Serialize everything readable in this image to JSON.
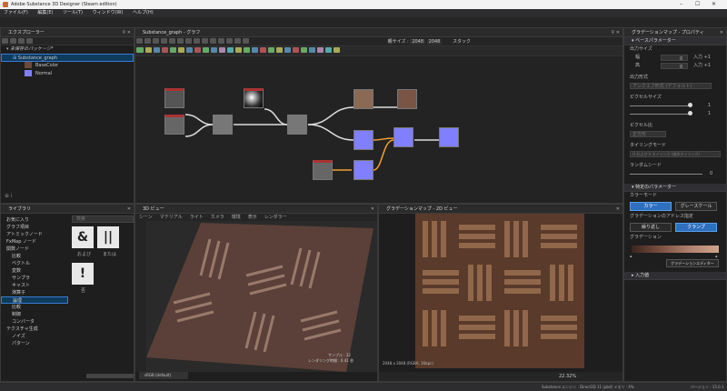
{
  "window": {
    "title": "Adobe Substance 3D Designer (Steam edition)"
  },
  "menu": [
    "ファイル(F)",
    "編集(E)",
    "ツール(T)",
    "ウィンドウ(W)",
    "ヘルプ(H)"
  ],
  "explorer": {
    "title": "エクスプローラー",
    "package": "未保存のパッケージ*",
    "graph": "Substance_graph",
    "outputs": [
      {
        "label": "BaseColor",
        "color": "#6b4a3a"
      },
      {
        "label": "Normal",
        "color": "#8080ff"
      }
    ]
  },
  "graph": {
    "title": "Substance_graph - グラフ",
    "size_label": "親サイズ :",
    "size1": "2048",
    "size2": "2048",
    "stack_label": "スタック"
  },
  "library": {
    "title": "ライブラリ",
    "search_placeholder": "検索",
    "items": [
      "お気に入り",
      "グラフ項目",
      "アトミックノード",
      "FxMap ノード",
      "関数ノード",
      "比較",
      "ベクトル",
      "変数",
      "サンプラ",
      "キャスト",
      "演算子",
      "論理",
      "比較",
      "制御",
      "コンバータ",
      "テクスチャ生成",
      "ノイズ",
      "パターン"
    ],
    "selected_index": 10,
    "tiles": [
      {
        "glyph": "&",
        "label": "および"
      },
      {
        "glyph": "||",
        "label": "または"
      },
      {
        "glyph": "!",
        "label": "否"
      }
    ]
  },
  "view3d": {
    "title": "3D ビュー",
    "menu": [
      "シーン",
      "マテリアル",
      "ライト",
      "カメラ",
      "環境",
      "表示",
      "レンダラー"
    ],
    "stats1": "サンプル : 32",
    "stats2": "レンダリング時間 : 0.41 秒",
    "colorspace": "sRGB (default)"
  },
  "view2d": {
    "title": "グラデーションマップ - 2D ビュー",
    "info": "2048 x 2048 (RGBA, 16bpc)",
    "zoom": "22.32%"
  },
  "props": {
    "title": "グラデーションマップ - プロパティ",
    "base_section": "ベースパラメーター",
    "output_size": "出力サイズ",
    "width_label": "幅",
    "height_label": "高",
    "width_val": "0",
    "height_val": "0",
    "rel_w": "入力 +1",
    "rel_h": "入力 +1",
    "output_format": "出力形式",
    "output_format_val": "アンクエフ形式 (デフォルト)",
    "pixel_size": "ピクセルサイズ",
    "px_w": "1",
    "px_h": "1",
    "pixel_ratio": "ピクセル比",
    "pixel_ratio_val": "正方形",
    "tiling": "タイリングモード",
    "tiling_val": "H および V タイリング (継承タイリング)",
    "seed": "ランダムシード",
    "seed_val": "0",
    "specific_section": "特定のパラメーター",
    "color_mode": "カラーモード",
    "btn_color": "カラー",
    "btn_gray": "グレースケール",
    "addressing": "グラデーションのアドレス指定",
    "btn_repeat": "繰り返し",
    "btn_clamp": "クランプ",
    "gradient": "グラデーション",
    "gradient_editor": "グラデーションエディター",
    "input_section": "入力値"
  },
  "status": {
    "engine": "Substance エンジン : Direct3D 11 (pbd) メモリ : 4%",
    "version": "バージョン : 15.0.1"
  }
}
